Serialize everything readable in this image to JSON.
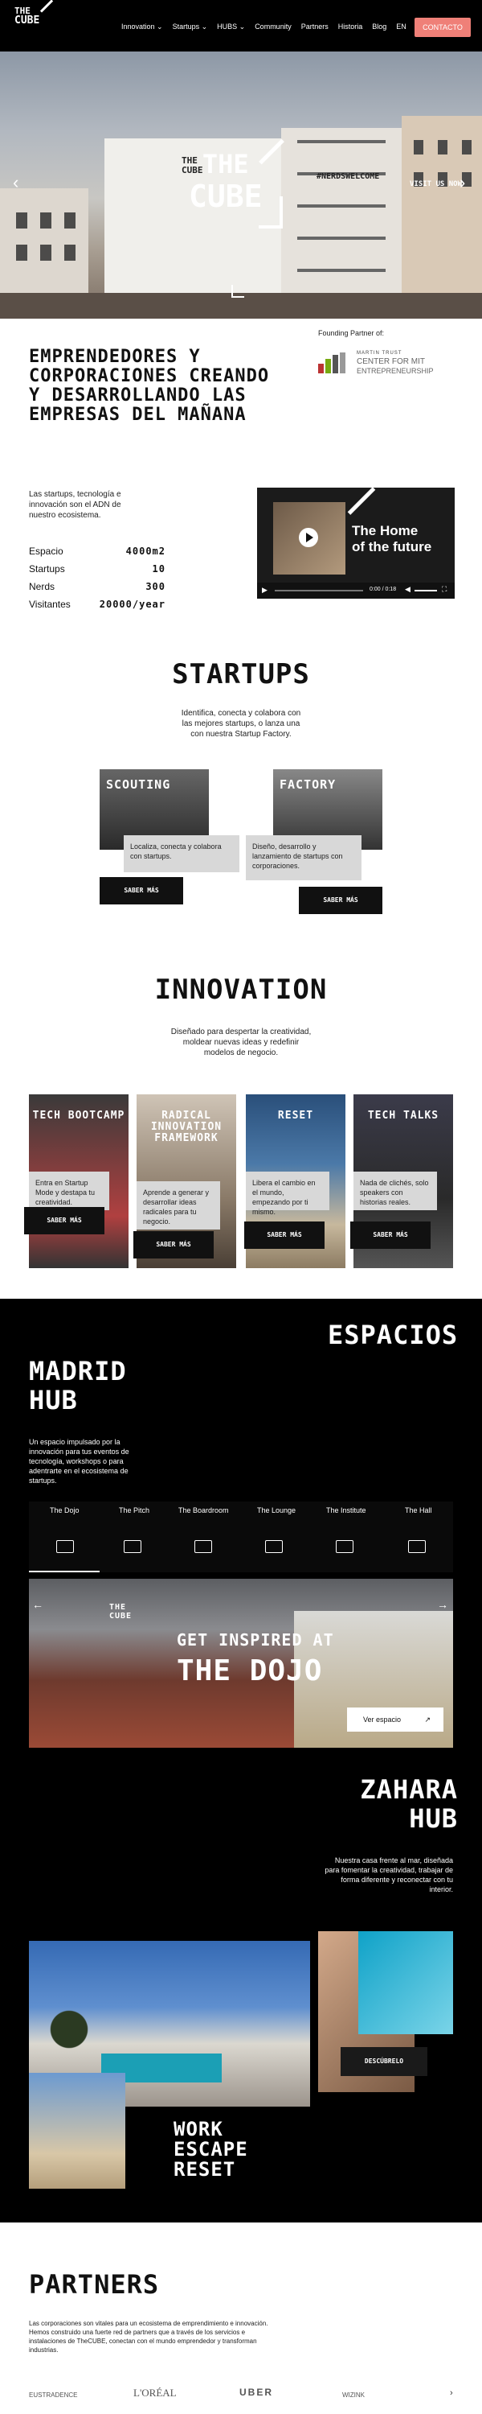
{
  "nav": {
    "logo": [
      "THE",
      "CUBE"
    ],
    "menu": [
      "Innovation ⌄",
      "Startups ⌄",
      "HUBS ⌄",
      "Community",
      "Partners",
      "Historia",
      "Blog",
      "EN"
    ],
    "cta": "CONTACTO"
  },
  "hero": {
    "wall_text": "#NERDSWELCOME",
    "visit_text": "VISIT US NOW",
    "logo_small": [
      "THE",
      "CUBE"
    ],
    "logo_big": [
      "THE",
      "CUBE"
    ]
  },
  "founding": {
    "label": "Founding Partner of:",
    "partner_line1": "MARTIN TRUST",
    "partner_line2": "CENTER FOR MIT",
    "partner_line3": "ENTREPRENEURSHIP"
  },
  "intro": {
    "headline": "EMPRENDEDORES Y CORPORACIONES CREANDO Y DESARROLLANDO LAS EMPRESAS DEL MAÑANA",
    "desc": "Las startups, tecnología e innovación son el ADN de nuestro ecosistema.",
    "stats": [
      {
        "label": "Espacio",
        "value": "4000m2"
      },
      {
        "label": "Startups",
        "value": "10"
      },
      {
        "label": "Nerds",
        "value": "300"
      },
      {
        "label": "Visitantes",
        "value": "20000/year"
      }
    ],
    "video": {
      "title_line1": "The Home",
      "title_line2": "of the future",
      "time": "0:00 / 0:18"
    }
  },
  "startups": {
    "title": "STARTUPS",
    "desc": "Identifica, conecta y colabora con las mejores startups, o lanza una con nuestra Startup Factory.",
    "cards": [
      {
        "title": "SCOUTING",
        "text": "Localiza, conecta y colabora con startups.",
        "button": "SABER MÁS"
      },
      {
        "title": "FACTORY",
        "text": "Diseño, desarrollo y lanzamiento de startups con corporaciones.",
        "button": "SABER MÁS"
      }
    ]
  },
  "innovation": {
    "title": "INNOVATION",
    "desc": "Diseñado para despertar la creatividad, moldear nuevas ideas y redefinir modelos de negocio.",
    "cards": [
      {
        "title": "TECH BOOTCAMP",
        "text": "Entra en Startup Mode y destapa tu creatividad.",
        "button": "SABER MÁS"
      },
      {
        "title": "RADICAL INNOVATION FRAMEWORK",
        "text": "Aprende a generar y desarrollar ideas radicales para tu negocio.",
        "button": "SABER MÁS"
      },
      {
        "title": "RESET",
        "text": "Libera el cambio en el mundo, empezando por ti mismo.",
        "button": "SABER MÁS"
      },
      {
        "title": "TECH TALKS",
        "text": "Nada de clichés, solo speakers con historias reales.",
        "button": "SABER MÁS"
      }
    ]
  },
  "espacios": {
    "title": "ESPACIOS",
    "madrid": {
      "title": "MADRID HUB",
      "desc": "Un espacio impulsado por la innovación para tus eventos de tecnología, workshops o para adentrarte en el ecosistema de startups.",
      "tabs": [
        "The Dojo",
        "The Pitch",
        "The Boardroom",
        "The Lounge",
        "The Institute",
        "The Hall"
      ],
      "banner_top": "GET INSPIRED AT",
      "banner_big": "THE DOJO",
      "button": "Ver espacio",
      "arrow_left": "←",
      "arrow_right": "→"
    },
    "zahara": {
      "title": "ZAHARA HUB",
      "desc": "Nuestra casa frente al mar, diseñada para fomentar la creatividad, trabajar de forma diferente y reconectar con tu interior.",
      "button": "DESCÚBRELO",
      "tagline": [
        "WORK",
        "ESCAPE",
        "RESET"
      ]
    }
  },
  "partners": {
    "title": "PARTNERS",
    "desc": "Las corporaciones son vitales para un ecosistema de emprendimiento e innovación. Hemos construido una fuerte red de partners que a través de los servicios e instalaciones de TheCUBE, conectan con el mundo emprendedor y transforman industrias.",
    "logos": [
      "EUSTRADENCE",
      "L'ORÉAL",
      "UBER",
      "WIZINK"
    ]
  },
  "colors": {
    "accent": "#ef8078",
    "dark": "#000000",
    "card_gray": "#d8d8d8"
  }
}
